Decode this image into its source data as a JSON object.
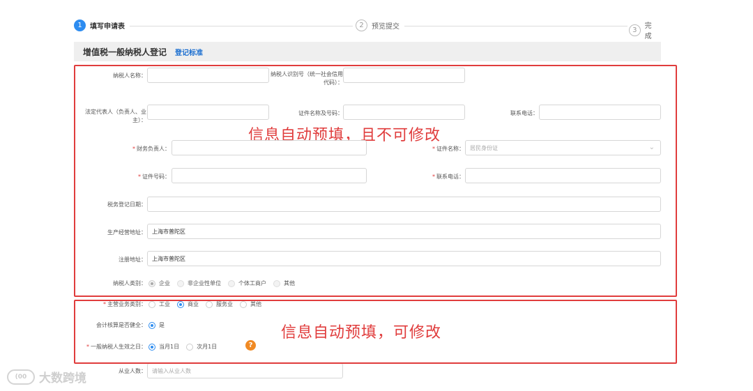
{
  "steps": [
    {
      "num": "1",
      "label": "填写申请表"
    },
    {
      "num": "2",
      "label": "预览提交"
    },
    {
      "num": "3",
      "label": "完成"
    }
  ],
  "section": {
    "title": "增值税一般纳税人登记",
    "link": "登记标准"
  },
  "annotations": {
    "autofill_locked": "信息自动预填，且不可修改",
    "autofill_editable": "信息自动预填，可修改"
  },
  "fields": {
    "taxpayer_name": {
      "label": "纳税人名称：",
      "value": ""
    },
    "taxpayer_id": {
      "label": "纳税人识别号（统一社会信用代码）：",
      "value": ""
    },
    "legal_rep": {
      "label": "法定代表人（负责人、业主）：",
      "value": ""
    },
    "cert_name_no": {
      "label": "证件名称及号码：",
      "value": ""
    },
    "phone1": {
      "label": "联系电话：",
      "value": ""
    },
    "finance_person": {
      "label": "财务负责人：",
      "value": ""
    },
    "cert_type": {
      "label": "证件名称：",
      "value": "居民身份证"
    },
    "cert_no": {
      "label": "证件号码：",
      "value": ""
    },
    "phone2": {
      "label": "联系电话：",
      "value": ""
    },
    "reg_date": {
      "label": "税务登记日期：",
      "value": ""
    },
    "biz_address": {
      "label": "生产经营地址：",
      "value": "上海市普陀区"
    },
    "reg_address": {
      "label": "注册地址：",
      "value": "上海市普陀区"
    },
    "taxpayer_type": {
      "label": "纳税人类别：",
      "options": [
        "企业",
        "非企业性单位",
        "个体工商户",
        "其他"
      ],
      "selected": "企业"
    },
    "main_biz": {
      "label": "主营业务类别：",
      "options": [
        "工业",
        "商业",
        "服务业",
        "其他"
      ],
      "selected": "商业"
    },
    "accounting": {
      "label": "会计核算是否健全：",
      "options": [
        "是"
      ],
      "selected": "是"
    },
    "effective_date": {
      "label": "一般纳税人生效之日：",
      "options": [
        "当月1日",
        "次月1日"
      ],
      "selected": "当月1日"
    },
    "employees": {
      "label": "从业人数：",
      "placeholder": "请输入从业人数"
    }
  },
  "help_icon": "?",
  "watermark": {
    "text": "大数跨境",
    "logo": "(00"
  },
  "colors": {
    "accent": "#2d8cf0",
    "annotation_red": "#e03c3c",
    "help_orange": "#f08a24"
  }
}
